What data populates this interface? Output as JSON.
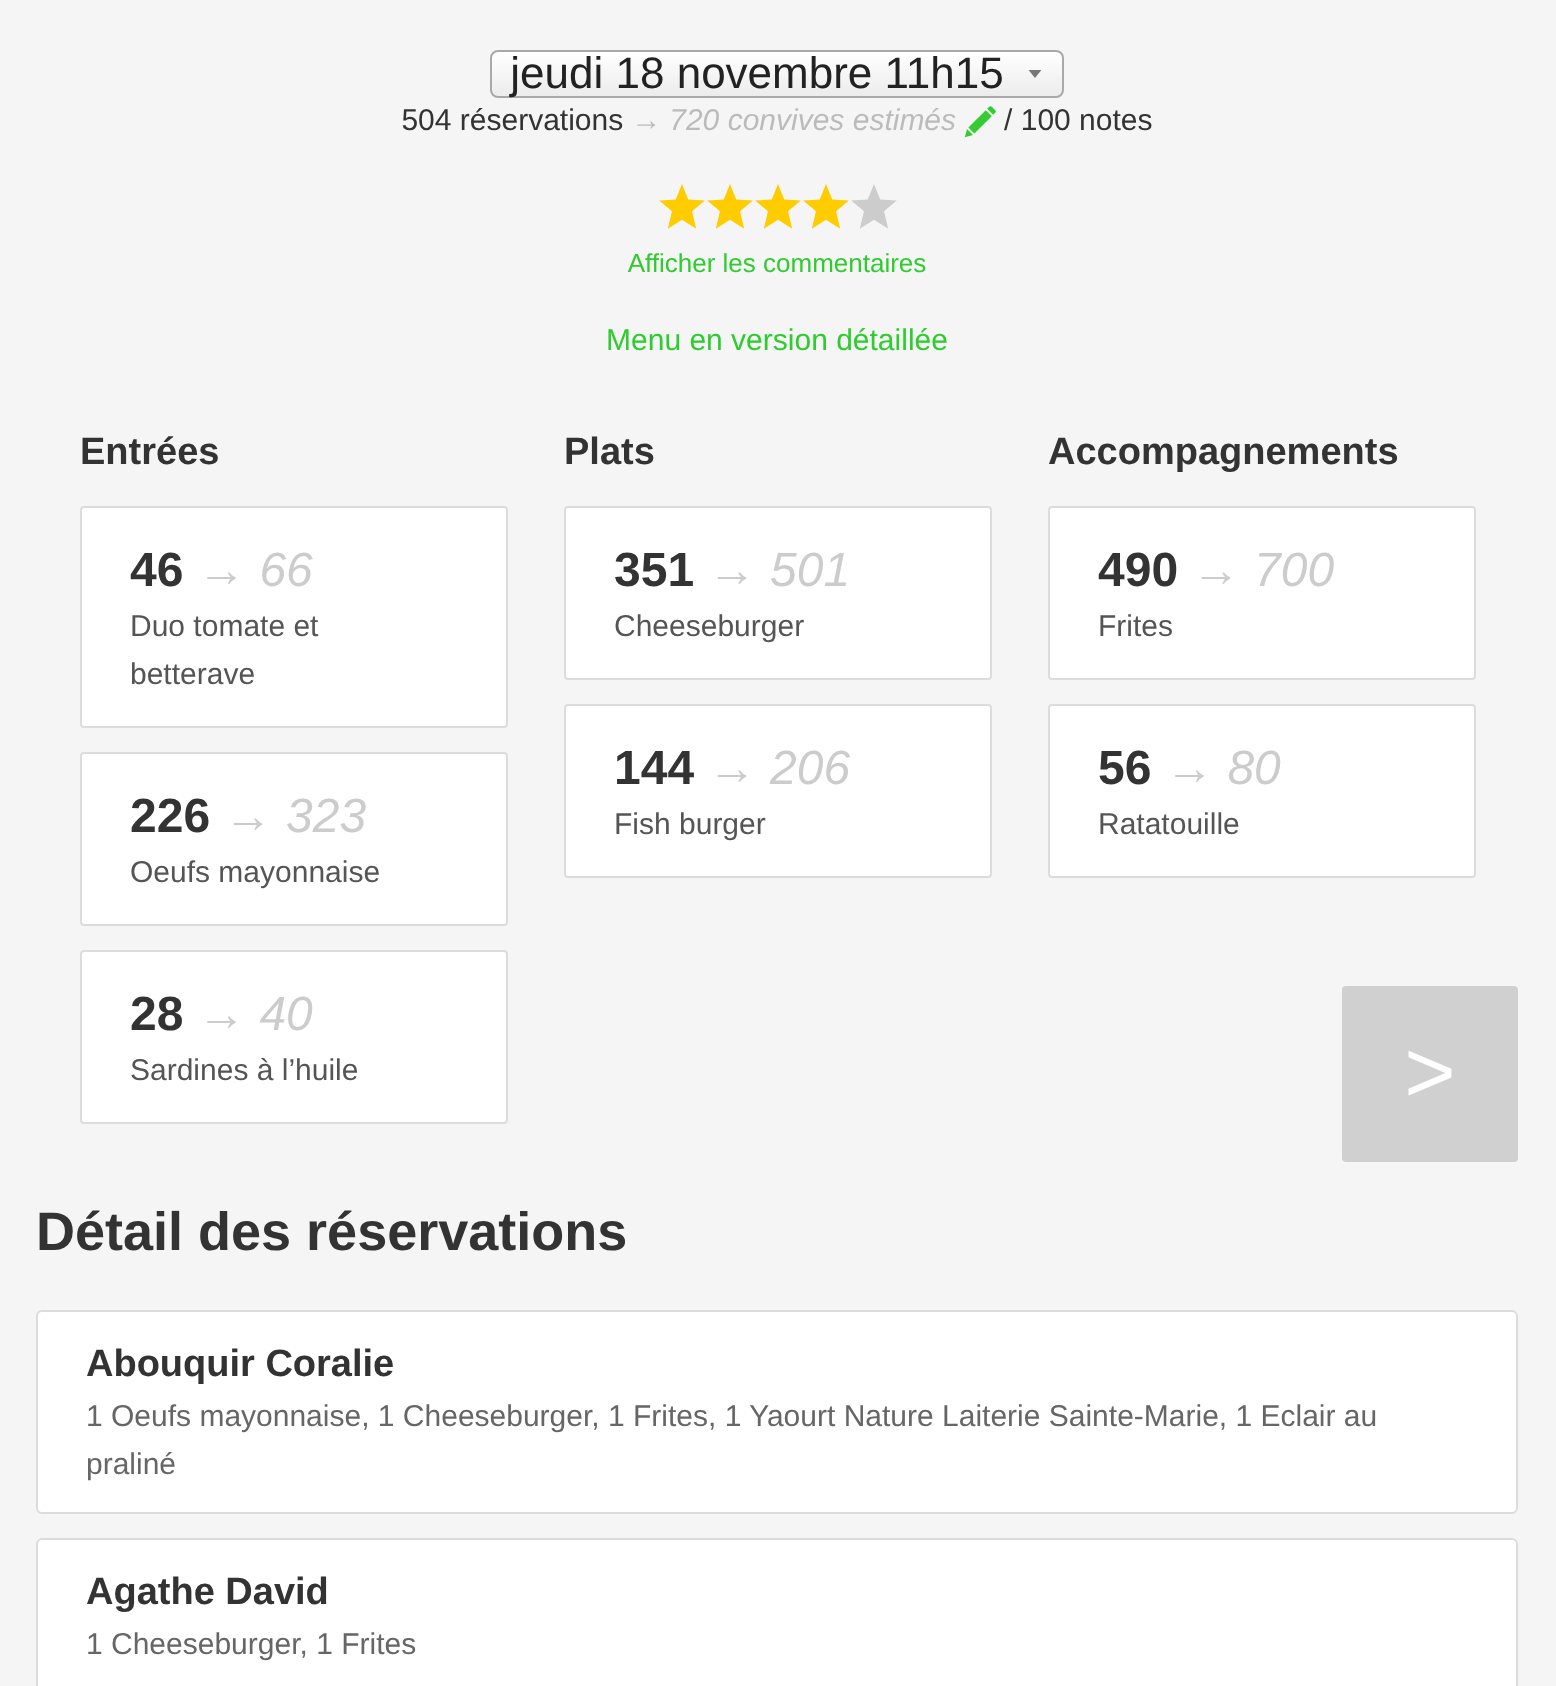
{
  "date_select": {
    "value": "jeudi 18 novembre 11h15"
  },
  "summary": {
    "reservations": "504 réservations",
    "arrow": "→",
    "estimate": "720 convives estimés",
    "notes": "/ 100 notes"
  },
  "rating": {
    "stars": 4,
    "comments_link": "Afficher les commentaires"
  },
  "menu_link": "Menu en version détaillée",
  "categories": [
    {
      "title": "Entrées",
      "dishes": [
        {
          "count": "46",
          "arrow": "→",
          "estimate": "66",
          "name": "Duo tomate et betterave"
        },
        {
          "count": "226",
          "arrow": "→",
          "estimate": "323",
          "name": "Oeufs mayonnaise"
        },
        {
          "count": "28",
          "arrow": "→",
          "estimate": "40",
          "name": "Sardines à l’huile"
        }
      ]
    },
    {
      "title": "Plats",
      "dishes": [
        {
          "count": "351",
          "arrow": "→",
          "estimate": "501",
          "name": "Cheeseburger"
        },
        {
          "count": "144",
          "arrow": "→",
          "estimate": "206",
          "name": "Fish burger"
        }
      ]
    },
    {
      "title": "Accompagnements",
      "dishes": [
        {
          "count": "490",
          "arrow": "→",
          "estimate": "700",
          "name": "Frites"
        },
        {
          "count": "56",
          "arrow": "→",
          "estimate": "80",
          "name": "Ratatouille"
        }
      ]
    }
  ],
  "next_button": {
    "label": ">"
  },
  "reservations": {
    "title": "Détail des réservations",
    "items": [
      {
        "name": "Abouquir Coralie",
        "order": "1 Oeufs mayonnaise, 1 Cheeseburger, 1 Frites, 1 Yaourt Nature Laiterie Sainte-Marie, 1 Eclair au praliné"
      },
      {
        "name": "Agathe David",
        "order": "1 Cheeseburger, 1 Frites"
      }
    ]
  }
}
